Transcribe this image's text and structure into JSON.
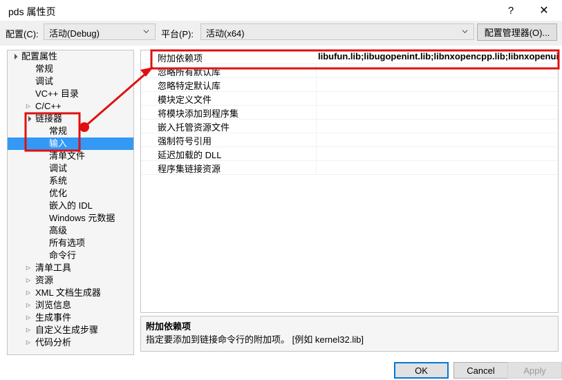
{
  "window": {
    "title": "pds 属性页",
    "help_icon": "question-mark-icon",
    "close_icon": "close-icon"
  },
  "config_bar": {
    "configuration_label": "配置(C):",
    "configuration_value": "活动(Debug)",
    "platform_label": "平台(P):",
    "platform_value": "活动(x64)",
    "config_manager_label": "配置管理器(O)...",
    "dropdown_icon": "chevron-down-icon"
  },
  "tree": {
    "items": [
      {
        "label": "配置属性",
        "indent": 0,
        "expander": "expanded",
        "selected": false
      },
      {
        "label": "常规",
        "indent": 1,
        "expander": "none",
        "selected": false
      },
      {
        "label": "调试",
        "indent": 1,
        "expander": "none",
        "selected": false
      },
      {
        "label": "VC++ 目录",
        "indent": 1,
        "expander": "none",
        "selected": false
      },
      {
        "label": "C/C++",
        "indent": 1,
        "expander": "collapsed",
        "selected": false
      },
      {
        "label": "链接器",
        "indent": 1,
        "expander": "expanded",
        "selected": false
      },
      {
        "label": "常规",
        "indent": 2,
        "expander": "none",
        "selected": false
      },
      {
        "label": "输入",
        "indent": 2,
        "expander": "none",
        "selected": true
      },
      {
        "label": "清单文件",
        "indent": 2,
        "expander": "none",
        "selected": false
      },
      {
        "label": "调试",
        "indent": 2,
        "expander": "none",
        "selected": false
      },
      {
        "label": "系统",
        "indent": 2,
        "expander": "none",
        "selected": false
      },
      {
        "label": "优化",
        "indent": 2,
        "expander": "none",
        "selected": false
      },
      {
        "label": "嵌入的 IDL",
        "indent": 2,
        "expander": "none",
        "selected": false
      },
      {
        "label": "Windows 元数据",
        "indent": 2,
        "expander": "none",
        "selected": false
      },
      {
        "label": "高级",
        "indent": 2,
        "expander": "none",
        "selected": false
      },
      {
        "label": "所有选项",
        "indent": 2,
        "expander": "none",
        "selected": false
      },
      {
        "label": "命令行",
        "indent": 2,
        "expander": "none",
        "selected": false
      },
      {
        "label": "清单工具",
        "indent": 1,
        "expander": "collapsed",
        "selected": false
      },
      {
        "label": "资源",
        "indent": 1,
        "expander": "collapsed",
        "selected": false
      },
      {
        "label": "XML 文档生成器",
        "indent": 1,
        "expander": "collapsed",
        "selected": false
      },
      {
        "label": "浏览信息",
        "indent": 1,
        "expander": "collapsed",
        "selected": false
      },
      {
        "label": "生成事件",
        "indent": 1,
        "expander": "collapsed",
        "selected": false
      },
      {
        "label": "自定义生成步骤",
        "indent": 1,
        "expander": "collapsed",
        "selected": false
      },
      {
        "label": "代码分析",
        "indent": 1,
        "expander": "collapsed",
        "selected": false
      }
    ]
  },
  "grid": {
    "rows": [
      {
        "name": "附加依赖项",
        "value": "libufun.lib;libugopenint.lib;libnxopencpp.lib;libnxopenuicpp.lib"
      },
      {
        "name": "忽略所有默认库",
        "value": ""
      },
      {
        "name": "忽略特定默认库",
        "value": ""
      },
      {
        "name": "模块定义文件",
        "value": ""
      },
      {
        "name": "将模块添加到程序集",
        "value": ""
      },
      {
        "name": "嵌入托管资源文件",
        "value": ""
      },
      {
        "name": "强制符号引用",
        "value": ""
      },
      {
        "name": "延迟加载的 DLL",
        "value": ""
      },
      {
        "name": "程序集链接资源",
        "value": ""
      }
    ]
  },
  "description": {
    "title": "附加依赖项",
    "text": "指定要添加到链接命令行的附加项。 [例如 kernel32.lib]"
  },
  "buttons": {
    "ok": "OK",
    "cancel": "Cancel",
    "apply": "Apply"
  },
  "annotations": {
    "highlight_color": "#e01010",
    "selection_color": "#3399f5"
  }
}
